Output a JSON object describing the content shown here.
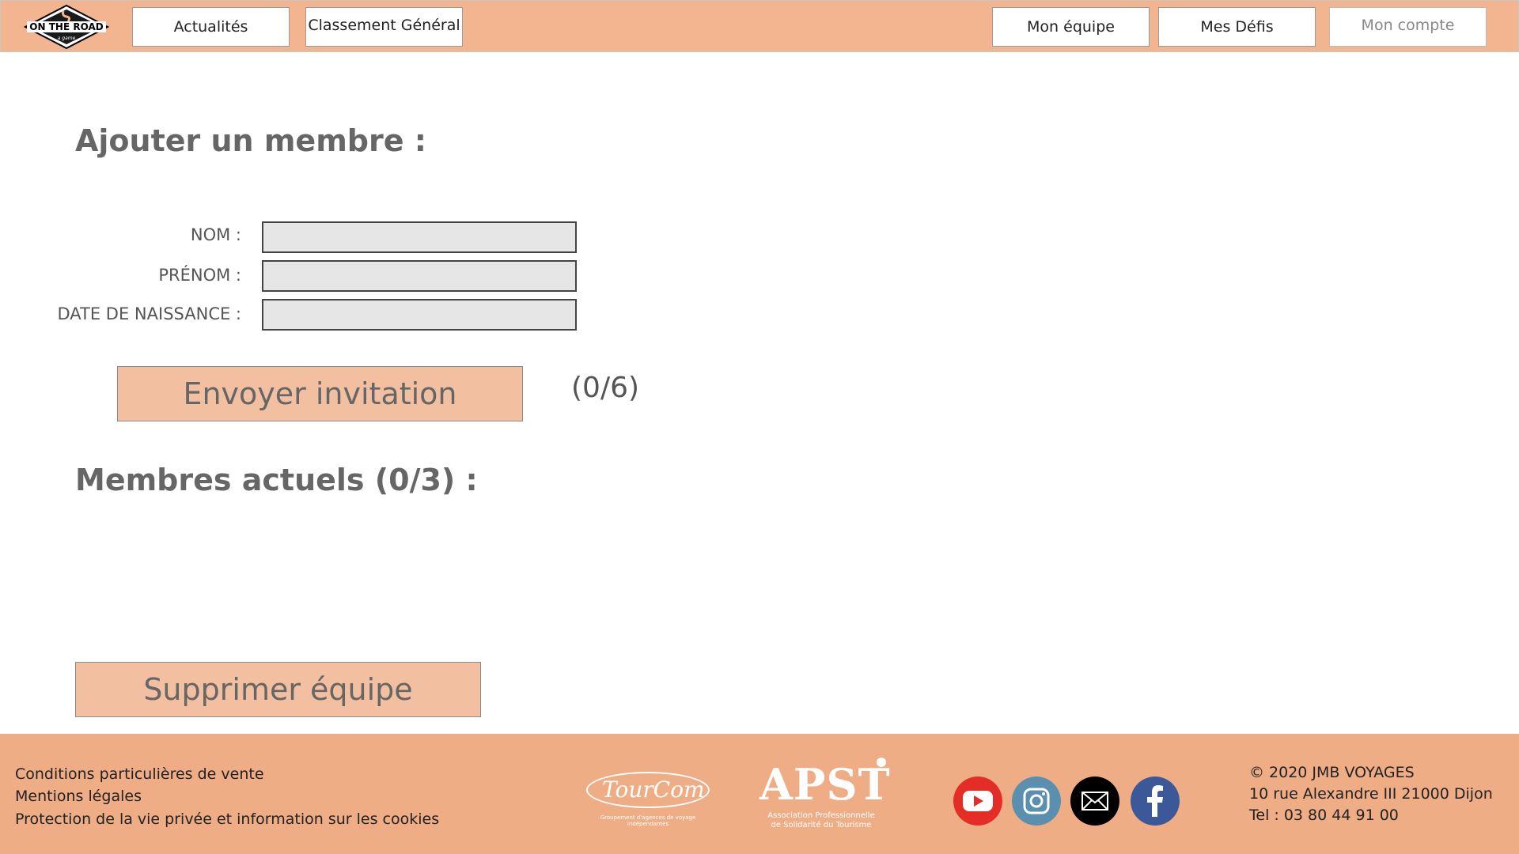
{
  "header": {
    "logo": {
      "text_main": "ON THE ROAD",
      "text_sub": "a game"
    },
    "nav": {
      "actualites": "Actualités",
      "classement": "Classement Général",
      "mon_equipe": "Mon équipe",
      "mes_defis": "Mes Défis",
      "mon_compte": "Mon compte"
    }
  },
  "main": {
    "add_member_title": "Ajouter un membre :",
    "form": {
      "nom_label": "NOM :",
      "nom_value": "",
      "prenom_label": "PRÉNOM :",
      "prenom_value": "",
      "date_label": "DATE DE NAISSANCE :",
      "date_value": ""
    },
    "send_invitation": "Envoyer invitation",
    "invitation_counter": "(0/6)",
    "current_members_title": "Membres actuels (0/3) :",
    "delete_team": "Supprimer équipe"
  },
  "footer": {
    "links": [
      "Conditions particulières de vente",
      "Mentions légales",
      "Protection de la vie privée et information sur les cookies"
    ],
    "partners": {
      "tourcom": {
        "name": "TourCom",
        "tagline": "Groupement d'agences de voyage indépendantes"
      },
      "apst": {
        "name": "APST",
        "tagline_1": "Association Professionnelle",
        "tagline_2": "de Solidarité du Tourisme"
      }
    },
    "social_icons": [
      "youtube-icon",
      "instagram-icon",
      "mail-icon",
      "facebook-icon"
    ],
    "social_colors": {
      "youtube": "#e52d27",
      "instagram": "#5b8fb0",
      "mail": "#000000",
      "facebook": "#3b5998"
    },
    "contact": {
      "copyright": "© 2020 JMB VOYAGES",
      "address": "10 rue Alexandre III 21000 Dijon",
      "phone": "Tel : 03 80 44 91 00"
    }
  },
  "colors": {
    "header_bg": "#f2b58f",
    "footer_bg": "#efad86",
    "button_bg": "#f2c0a0",
    "input_bg": "#e6e6e6"
  }
}
